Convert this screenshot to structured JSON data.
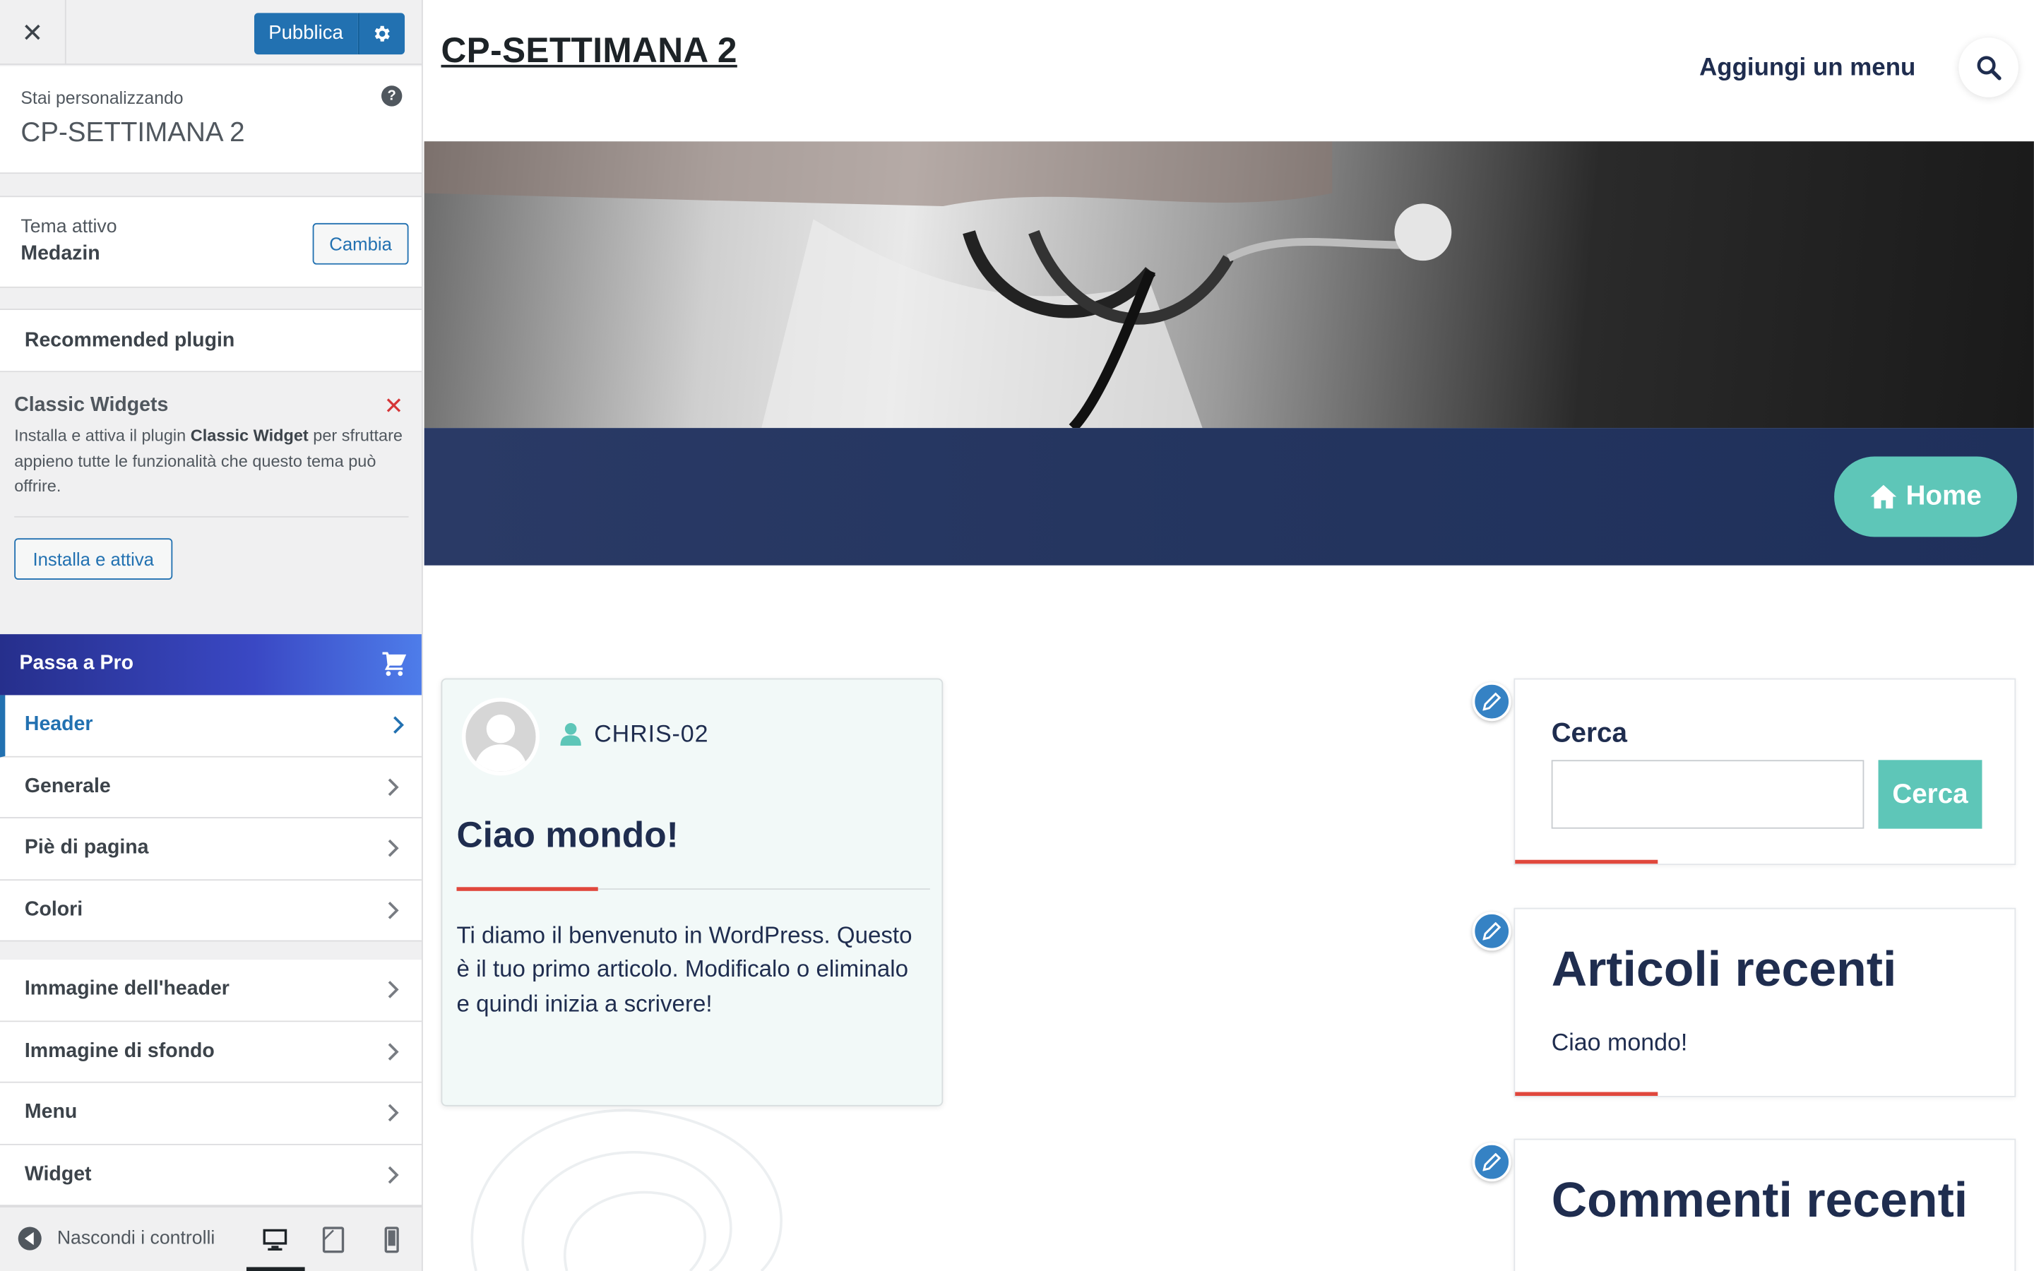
{
  "customizer": {
    "close_label": "✕",
    "publish_label": "Pubblica",
    "customizing_label": "Stai personalizzando",
    "site_name": "CP-SETTIMANA 2",
    "help_label": "?",
    "active_theme_label": "Tema attivo",
    "active_theme_name": "Medazin",
    "change_label": "Cambia",
    "recommended_heading": "Recommended plugin",
    "plugin_notice": {
      "title": "Classic Widgets",
      "dismiss_label": "✕",
      "desc_before": "Installa e attiva il plugin ",
      "desc_bold": "Classic Widget",
      "desc_after": " per sfruttare appieno tutte le funzionalità che questo tema può offrire.",
      "install_label": "Installa e attiva"
    },
    "pro_label": "Passa a Pro",
    "nav_group1": [
      {
        "label": "Header",
        "active": true
      },
      {
        "label": "Generale"
      },
      {
        "label": "Piè di pagina"
      },
      {
        "label": "Colori"
      }
    ],
    "nav_group2": [
      {
        "label": "Immagine dell'header"
      },
      {
        "label": "Immagine di sfondo"
      },
      {
        "label": "Menu"
      },
      {
        "label": "Widget"
      }
    ],
    "hide_controls_label": "Nascondi i controlli",
    "devices": [
      "desktop-icon",
      "tablet-icon",
      "mobile-icon"
    ],
    "active_device": "desktop"
  },
  "site": {
    "title": "CP-SETTIMANA 2",
    "menu_label": "Aggiungi un menu",
    "home_button": "Home",
    "post": {
      "author": "CHRIS-02",
      "title": "Ciao mondo!",
      "body": "Ti diamo il benvenuto in WordPress. Questo è il tuo primo articolo. Modificalo o eliminalo e quindi inizia a scrivere!"
    },
    "widgets": {
      "search_title": "Cerca",
      "search_button": "Cerca",
      "recent_posts_title": "Articoli recenti",
      "recent_posts": [
        "Ciao mondo!"
      ],
      "recent_comments_title": "Commenti recenti"
    }
  },
  "colors": {
    "wp_blue": "#2271b1",
    "navy_text": "#1f2d4f",
    "teal_accent": "#5ec6b8",
    "red_accent": "#e0473c",
    "banner": "#24355f"
  }
}
